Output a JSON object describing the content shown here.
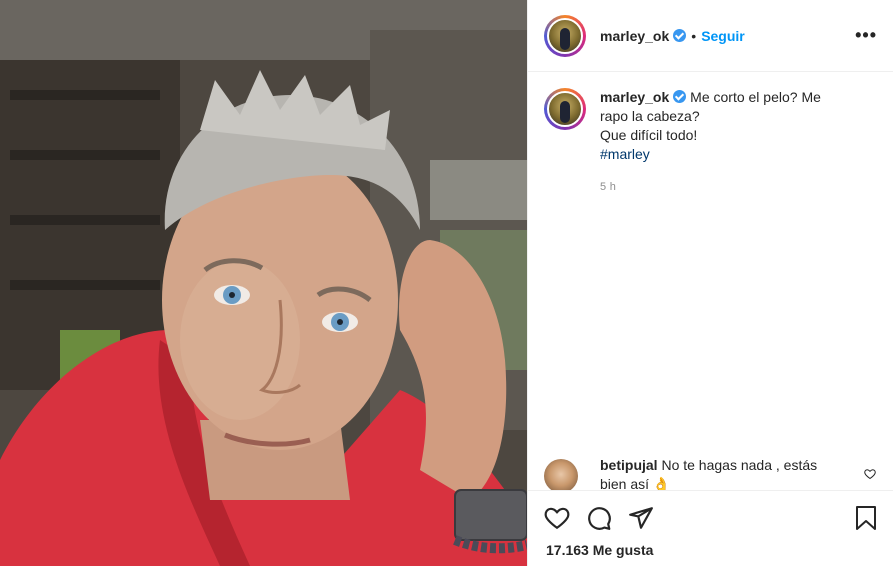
{
  "post": {
    "username": "marley_ok",
    "follow_label": "Seguir",
    "separator": "•",
    "more_label": "•••",
    "caption": {
      "line1": "Me corto el pelo? Me",
      "line2": "rapo la cabeza?",
      "line3": "Que difícil todo!",
      "hashtag": "#marley"
    },
    "time": "5 h",
    "comment": {
      "username": "betipujal",
      "text": "No te hagas nada , estás bien así 👌"
    },
    "likes": "17.163 Me gusta"
  },
  "colors": {
    "link_blue": "#0095f6",
    "hashtag_blue": "#00376b",
    "verified_blue": "#3897f0",
    "sweater_red": "#d8323f"
  },
  "icons": [
    "verified-icon",
    "more-options-icon",
    "heart-icon",
    "comment-icon",
    "share-icon",
    "bookmark-icon",
    "comment-like-icon"
  ]
}
